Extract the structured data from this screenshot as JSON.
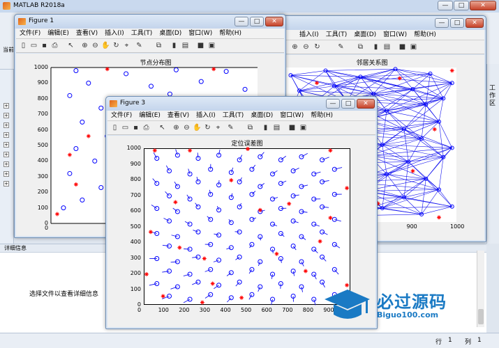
{
  "app": {
    "title": "MATLAB R2018a",
    "min_label": "—",
    "max_label": "□",
    "close_label": "✕",
    "side_tab_label": "工作区",
    "left_label": "当前",
    "detail_header": "详细信息",
    "detail_message": "选择文件以查看详细信息",
    "status_row_label": "行",
    "status_row_value": "1",
    "status_col_label": "列",
    "status_col_value": "1"
  },
  "menu": [
    "文件(F)",
    "编辑(E)",
    "查看(V)",
    "插入(I)",
    "工具(T)",
    "桌面(D)",
    "窗口(W)",
    "帮助(H)"
  ],
  "figure1": {
    "title": "Figure 1",
    "chart_data": {
      "type": "scatter",
      "title": "节点分布图",
      "xlim": [
        0,
        1000
      ],
      "ylim": [
        0,
        1000
      ],
      "yticks": [
        "0",
        "100",
        "200",
        "300",
        "400",
        "500",
        "600",
        "700",
        "800",
        "900",
        "1000"
      ],
      "xticks": [
        "0",
        "100",
        "200",
        "300"
      ],
      "series": [
        {
          "marker": "o",
          "color": "#0000ff",
          "points": [
            [
              40,
              980
            ],
            [
              120,
              960
            ],
            [
              200,
              985
            ],
            [
              280,
              975
            ],
            [
              60,
              900
            ],
            [
              160,
              880
            ],
            [
              240,
              910
            ],
            [
              310,
              860
            ],
            [
              30,
              820
            ],
            [
              110,
              790
            ],
            [
              190,
              830
            ],
            [
              260,
              800
            ],
            [
              80,
              740
            ],
            [
              150,
              710
            ],
            [
              220,
              760
            ],
            [
              300,
              720
            ],
            [
              50,
              650
            ],
            [
              130,
              620
            ],
            [
              210,
              670
            ],
            [
              280,
              640
            ],
            [
              90,
              560
            ],
            [
              170,
              590
            ],
            [
              240,
              540
            ],
            [
              310,
              600
            ],
            [
              40,
              480
            ],
            [
              120,
              450
            ],
            [
              200,
              500
            ],
            [
              270,
              470
            ],
            [
              70,
              400
            ],
            [
              150,
              370
            ],
            [
              230,
              420
            ],
            [
              300,
              390
            ],
            [
              30,
              320
            ],
            [
              110,
              290
            ],
            [
              190,
              330
            ],
            [
              260,
              300
            ],
            [
              80,
              230
            ],
            [
              160,
              200
            ],
            [
              240,
              250
            ],
            [
              50,
              150
            ],
            [
              130,
              120
            ],
            [
              210,
              160
            ],
            [
              290,
              130
            ],
            [
              100,
              60
            ],
            [
              180,
              40
            ],
            [
              260,
              80
            ],
            [
              20,
              100
            ],
            [
              310,
              210
            ]
          ]
        },
        {
          "marker": "*",
          "color": "#ff0000",
          "points": [
            [
              90,
              990
            ],
            [
              260,
              990
            ],
            [
              30,
              440
            ],
            [
              100,
              380
            ],
            [
              60,
              560
            ],
            [
              140,
              640
            ],
            [
              230,
              680
            ],
            [
              200,
              320
            ],
            [
              40,
              250
            ],
            [
              150,
              160
            ],
            [
              220,
              100
            ],
            [
              290,
              280
            ],
            [
              120,
              500
            ],
            [
              10,
              60
            ]
          ]
        }
      ]
    }
  },
  "figure2": {
    "chart_data": {
      "type": "scatter",
      "title": "邻居关系图",
      "xticks": [
        "700",
        "800",
        "900",
        "1000"
      ],
      "xlim": [
        600,
        1000
      ],
      "ylim": [
        0,
        1000
      ],
      "note_nodes": [
        [
          620,
          950
        ],
        [
          700,
          980
        ],
        [
          780,
          940
        ],
        [
          860,
          990
        ],
        [
          940,
          960
        ],
        [
          990,
          900
        ],
        [
          640,
          850
        ],
        [
          720,
          880
        ],
        [
          810,
          830
        ],
        [
          900,
          860
        ],
        [
          970,
          800
        ],
        [
          660,
          740
        ],
        [
          750,
          780
        ],
        [
          840,
          720
        ],
        [
          930,
          760
        ],
        [
          610,
          640
        ],
        [
          700,
          620
        ],
        [
          790,
          660
        ],
        [
          880,
          600
        ],
        [
          960,
          650
        ],
        [
          650,
          520
        ],
        [
          740,
          560
        ],
        [
          830,
          500
        ],
        [
          920,
          540
        ],
        [
          990,
          480
        ],
        [
          620,
          420
        ],
        [
          710,
          380
        ],
        [
          800,
          430
        ],
        [
          890,
          390
        ],
        [
          970,
          420
        ],
        [
          660,
          300
        ],
        [
          750,
          260
        ],
        [
          840,
          310
        ],
        [
          930,
          280
        ],
        [
          610,
          180
        ],
        [
          700,
          140
        ],
        [
          790,
          200
        ],
        [
          880,
          160
        ],
        [
          960,
          210
        ],
        [
          650,
          60
        ],
        [
          740,
          40
        ],
        [
          830,
          90
        ],
        [
          920,
          50
        ],
        [
          990,
          100
        ]
      ],
      "anchors": [
        [
          680,
          900
        ],
        [
          870,
          930
        ],
        [
          760,
          700
        ],
        [
          950,
          600
        ],
        [
          700,
          450
        ],
        [
          900,
          330
        ],
        [
          640,
          220
        ],
        [
          820,
          120
        ],
        [
          960,
          30
        ],
        [
          990,
          980
        ]
      ]
    }
  },
  "figure3": {
    "title": "Figure 3",
    "chart_data": {
      "type": "scatter",
      "title": "定位误差图",
      "xlim": [
        0,
        1000
      ],
      "ylim": [
        0,
        1000
      ],
      "xticks": [
        "0",
        "100",
        "200",
        "300",
        "400",
        "500",
        "600",
        "700",
        "800",
        "900"
      ],
      "yticks": [
        "0",
        "100",
        "200",
        "300",
        "400",
        "500",
        "600",
        "700",
        "800",
        "900",
        "1000"
      ],
      "estimated_points": [
        [
          60,
          940
        ],
        [
          160,
          960
        ],
        [
          260,
          940
        ],
        [
          360,
          960
        ],
        [
          460,
          930
        ],
        [
          560,
          950
        ],
        [
          660,
          930
        ],
        [
          760,
          950
        ],
        [
          860,
          930
        ],
        [
          120,
          860
        ],
        [
          220,
          840
        ],
        [
          320,
          870
        ],
        [
          420,
          850
        ],
        [
          520,
          870
        ],
        [
          620,
          840
        ],
        [
          720,
          860
        ],
        [
          820,
          840
        ],
        [
          920,
          870
        ],
        [
          60,
          780
        ],
        [
          160,
          760
        ],
        [
          260,
          790
        ],
        [
          360,
          770
        ],
        [
          460,
          790
        ],
        [
          560,
          760
        ],
        [
          660,
          780
        ],
        [
          760,
          760
        ],
        [
          860,
          790
        ],
        [
          120,
          700
        ],
        [
          220,
          680
        ],
        [
          320,
          710
        ],
        [
          420,
          690
        ],
        [
          520,
          710
        ],
        [
          620,
          680
        ],
        [
          720,
          700
        ],
        [
          820,
          680
        ],
        [
          920,
          710
        ],
        [
          60,
          620
        ],
        [
          160,
          600
        ],
        [
          260,
          630
        ],
        [
          360,
          610
        ],
        [
          460,
          630
        ],
        [
          560,
          600
        ],
        [
          660,
          620
        ],
        [
          760,
          600
        ],
        [
          860,
          630
        ],
        [
          120,
          540
        ],
        [
          220,
          520
        ],
        [
          320,
          550
        ],
        [
          420,
          530
        ],
        [
          520,
          550
        ],
        [
          620,
          520
        ],
        [
          720,
          540
        ],
        [
          820,
          520
        ],
        [
          920,
          550
        ],
        [
          60,
          460
        ],
        [
          160,
          440
        ],
        [
          260,
          470
        ],
        [
          360,
          450
        ],
        [
          460,
          470
        ],
        [
          560,
          440
        ],
        [
          660,
          460
        ],
        [
          760,
          440
        ],
        [
          860,
          470
        ],
        [
          120,
          380
        ],
        [
          220,
          360
        ],
        [
          320,
          390
        ],
        [
          420,
          370
        ],
        [
          520,
          390
        ],
        [
          620,
          360
        ],
        [
          720,
          380
        ],
        [
          820,
          360
        ],
        [
          920,
          390
        ],
        [
          60,
          300
        ],
        [
          160,
          280
        ],
        [
          260,
          310
        ],
        [
          360,
          290
        ],
        [
          460,
          310
        ],
        [
          560,
          280
        ],
        [
          660,
          300
        ],
        [
          760,
          280
        ],
        [
          860,
          310
        ],
        [
          120,
          220
        ],
        [
          220,
          200
        ],
        [
          320,
          230
        ],
        [
          420,
          210
        ],
        [
          520,
          230
        ],
        [
          620,
          200
        ],
        [
          720,
          220
        ],
        [
          820,
          200
        ],
        [
          920,
          230
        ],
        [
          60,
          140
        ],
        [
          160,
          120
        ],
        [
          260,
          150
        ],
        [
          360,
          130
        ],
        [
          460,
          150
        ],
        [
          560,
          120
        ],
        [
          660,
          140
        ],
        [
          760,
          120
        ],
        [
          860,
          150
        ],
        [
          120,
          60
        ],
        [
          220,
          40
        ],
        [
          320,
          70
        ],
        [
          420,
          50
        ],
        [
          520,
          70
        ],
        [
          620,
          40
        ],
        [
          720,
          60
        ],
        [
          820,
          40
        ],
        [
          920,
          70
        ]
      ],
      "anchors": [
        [
          50,
          990
        ],
        [
          220,
          990
        ],
        [
          500,
          1000
        ],
        [
          900,
          990
        ],
        [
          980,
          750
        ],
        [
          900,
          560
        ],
        [
          30,
          470
        ],
        [
          170,
          370
        ],
        [
          290,
          300
        ],
        [
          640,
          330
        ],
        [
          780,
          220
        ],
        [
          10,
          200
        ],
        [
          330,
          140
        ],
        [
          980,
          130
        ],
        [
          90,
          60
        ],
        [
          470,
          50
        ],
        [
          280,
          20
        ],
        [
          700,
          650
        ],
        [
          420,
          800
        ],
        [
          150,
          660
        ],
        [
          560,
          610
        ],
        [
          850,
          410
        ],
        [
          970,
          30
        ]
      ]
    }
  },
  "watermark": {
    "text_cn": "必过源码",
    "text_en": "Biguo100.com"
  }
}
